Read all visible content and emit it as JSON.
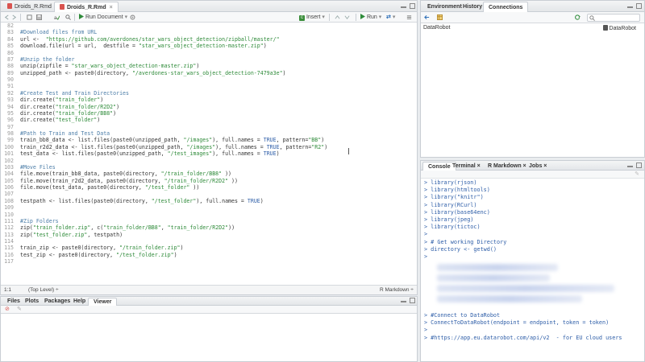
{
  "editor": {
    "tabs": [
      {
        "label": "Droids_R.Rmd"
      },
      {
        "label": "Droids_R.Rmd"
      }
    ],
    "toolbar": {
      "run_document": "Run Document",
      "insert": "Insert",
      "run": "Run"
    },
    "lines": [
      {
        "num": "82",
        "text": ""
      },
      {
        "num": "83",
        "text": "#Download files from URL"
      },
      {
        "num": "84",
        "text": "url <-  \"https://github.com/averdones/star_wars_object_detection/zipball/master/\""
      },
      {
        "num": "85",
        "text": "download.file(url = url,  destfile = \"star_wars_object_detection-master.zip\")"
      },
      {
        "num": "86",
        "text": ""
      },
      {
        "num": "87",
        "text": "#Unzip the folder"
      },
      {
        "num": "88",
        "text": "unzip(zipfile = \"star_wars_object_detection-master.zip\")"
      },
      {
        "num": "89",
        "text": "unzipped_path <- paste0(directory, \"/averdones-star_wars_object_detection-7479a3e\")"
      },
      {
        "num": "90",
        "text": ""
      },
      {
        "num": "91",
        "text": ""
      },
      {
        "num": "92",
        "text": "#Create Test and Train Directories"
      },
      {
        "num": "93",
        "text": "dir.create(\"train_folder\")"
      },
      {
        "num": "94",
        "text": "dir.create(\"train_folder/R2D2\")"
      },
      {
        "num": "95",
        "text": "dir.create(\"train_folder/BB8\")"
      },
      {
        "num": "96",
        "text": "dir.create(\"test_folder\")"
      },
      {
        "num": "97",
        "text": ""
      },
      {
        "num": "98",
        "text": "#Path to Train and Test Data"
      },
      {
        "num": "99",
        "text": "train_bb8_data <- list.files(paste0(unzipped_path, \"/images\"), full.names = TRUE, pattern=\"BB\")"
      },
      {
        "num": "100",
        "text": "train_r2d2_data <- list.files(paste0(unzipped_path, \"/images\"), full.names = TRUE, pattern=\"R2\")"
      },
      {
        "num": "101",
        "text": "test_data <- list.files(paste0(unzipped_path, \"/test_images\"), full.names = TRUE)"
      },
      {
        "num": "102",
        "text": ""
      },
      {
        "num": "103",
        "text": "#Move Files"
      },
      {
        "num": "104",
        "text": "file.move(train_bb8_data, paste0(directory, \"/train_folder/BB8\" ))"
      },
      {
        "num": "105",
        "text": "file.move(train_r2d2_data, paste0(directory, \"/train_folder/R2D2\" ))"
      },
      {
        "num": "106",
        "text": "file.move(test_data, paste0(directory, \"/test_folder\" ))"
      },
      {
        "num": "107",
        "text": ""
      },
      {
        "num": "108",
        "text": "testpath <- list.files(paste0(directory, \"/test_folder\"), full.names = TRUE)"
      },
      {
        "num": "109",
        "text": ""
      },
      {
        "num": "110",
        "text": ""
      },
      {
        "num": "111",
        "text": "#Zip Folders"
      },
      {
        "num": "112",
        "text": "zip(\"train_folder.zip\", c(\"train_folder/BB8\", \"train_folder/R2D2\"))"
      },
      {
        "num": "113",
        "text": "zip(\"test_folder.zip\", testpath)"
      },
      {
        "num": "114",
        "text": ""
      },
      {
        "num": "115",
        "text": "train_zip <- paste0(directory, \"/train_folder.zip\")"
      },
      {
        "num": "116",
        "text": "test_zip <- paste0(directory, \"/test_folder.zip\")"
      },
      {
        "num": "117",
        "text": ""
      }
    ],
    "status": {
      "position": "1:1",
      "scope": "(Top Level) ÷",
      "mode": "R Markdown ÷"
    }
  },
  "files_pane": {
    "tabs": [
      "Files",
      "Plots",
      "Packages",
      "Help",
      "Viewer"
    ]
  },
  "env_pane": {
    "tabs": [
      "Environment",
      "History",
      "Connections"
    ],
    "connection_name": "DataRobot",
    "connection_label": "DataRobot"
  },
  "console_pane": {
    "tabs": [
      "Console",
      "Terminal ×",
      "R Markdown ×",
      "Jobs ×"
    ],
    "lines_top": [
      "> library(rjson)",
      "> library(htmltools)",
      "> library(\"knitr\")",
      "> library(RCurl)",
      "> library(base64enc)",
      "> library(jpeg)",
      "> library(tictoc)",
      ">",
      "> # Get working Directory",
      "> directory <- getwd()",
      ">"
    ],
    "lines_bottom": [
      "> #Connect to DataRobot",
      "> ConnectToDataRobot(endpoint = endpoint, token = token)",
      ">",
      "> #https://app.eu.datarobot.com/api/v2  - for EU cloud users"
    ]
  }
}
